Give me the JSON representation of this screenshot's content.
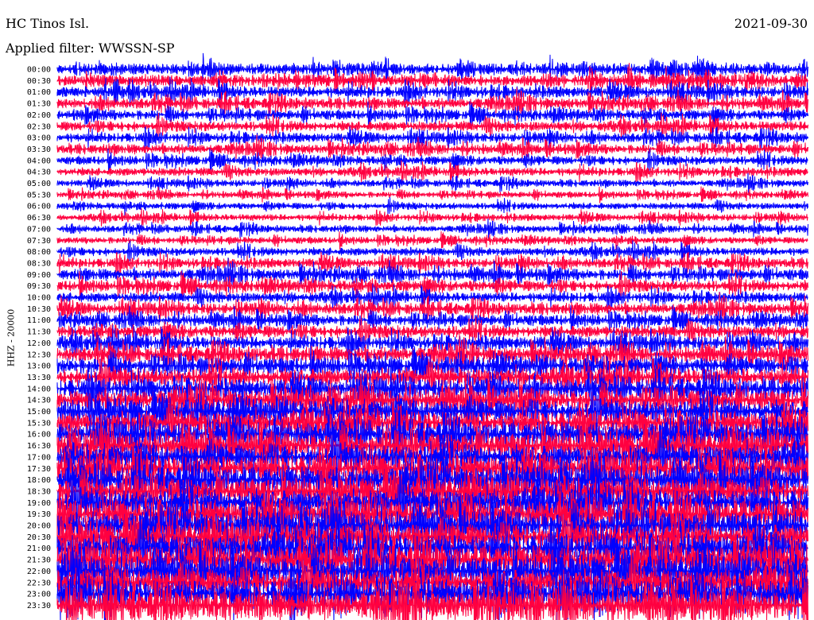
{
  "header": {
    "station": "HC Tinos Isl.",
    "date": "2021-09-30",
    "filter": "Applied filter: WWSSN-SP"
  },
  "chart_data": {
    "type": "line",
    "title": "HC Tinos Isl.",
    "ylabel": "HHZ - 20000",
    "row_labels": [
      "00:00",
      "00:30",
      "01:00",
      "01:30",
      "02:00",
      "02:30",
      "03:00",
      "03:30",
      "04:00",
      "04:30",
      "05:00",
      "05:30",
      "06:00",
      "06:30",
      "07:00",
      "07:30",
      "08:00",
      "08:30",
      "09:00",
      "09:30",
      "10:00",
      "10:30",
      "11:00",
      "11:30",
      "12:00",
      "12:30",
      "13:00",
      "13:30",
      "14:00",
      "14:30",
      "15:00",
      "15:30",
      "16:00",
      "16:30",
      "17:00",
      "17:30",
      "18:00",
      "18:30",
      "19:00",
      "19:30",
      "20:00",
      "20:30",
      "21:00",
      "21:30",
      "22:00",
      "22:30",
      "23:00",
      "23:30"
    ],
    "trace_colors": [
      "#0000ff",
      "#ff0040"
    ],
    "noise_level": [
      1.0,
      1.0,
      1.0,
      0.95,
      0.9,
      0.9,
      0.85,
      0.85,
      0.8,
      0.75,
      0.6,
      0.55,
      0.6,
      0.6,
      0.6,
      0.6,
      0.75,
      0.85,
      1.0,
      1.0,
      0.9,
      1.0,
      1.0,
      1.1,
      1.2,
      1.3,
      1.5,
      1.6,
      1.7,
      1.8,
      2.0,
      2.0,
      2.1,
      2.2,
      2.2,
      2.3,
      2.3,
      2.3,
      2.4,
      2.4,
      2.4,
      2.4,
      2.5,
      2.5,
      2.5,
      2.5,
      2.5,
      2.5
    ]
  }
}
